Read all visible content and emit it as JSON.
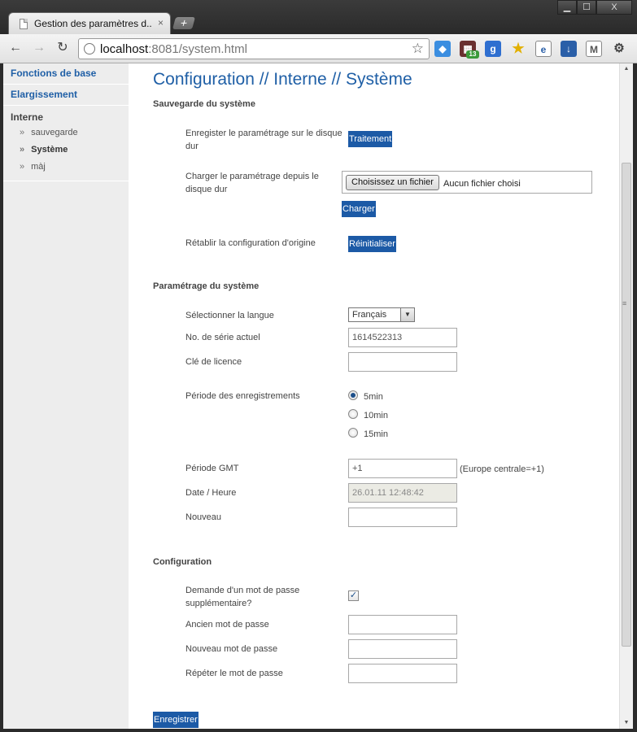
{
  "browser": {
    "tab_title": "Gestion des paramètres d...",
    "tab_close": "×",
    "newtab": "+",
    "url_host": "localhost",
    "url_rest": ":8081/system.html",
    "win_min": "▁",
    "win_max": "☐",
    "win_close": "X",
    "extensions": [
      "dropbox-icon",
      "calendar-icon",
      "google-icon",
      "star-icon",
      "notes-icon",
      "download-icon",
      "gmail-icon",
      "wrench-icon"
    ],
    "ext_badge": "13"
  },
  "sidebar": {
    "items": [
      {
        "label": "Fonctions de base"
      },
      {
        "label": "Elargissement"
      }
    ],
    "group_title": "Interne",
    "subitems": [
      {
        "label": "sauvegarde"
      },
      {
        "label": "Système"
      },
      {
        "label": "màj"
      }
    ],
    "bullet": "»"
  },
  "page": {
    "title": "Configuration // Interne // Système",
    "backup": {
      "section_title": "Sauvegarde du système",
      "save_label": "Enregister le paramétrage sur le disque dur",
      "save_button": "Traitement",
      "load_label": "Charger le paramétrage depuis le disque dur",
      "file_button": "Choisissez un fichier",
      "file_status": "Aucun fichier choisi",
      "load_button": "Charger",
      "reset_label": "Rétablir la configuration d'origine",
      "reset_button": "Réinitialiser"
    },
    "system": {
      "section_title": "Paramétrage du système",
      "language_label": "Sélectionner la langue",
      "language_value": "Français",
      "serial_label": "No. de série actuel",
      "serial_value": "1614522313",
      "license_label": "Clé de licence",
      "license_value": "",
      "period_label": "Période des enregistrements",
      "period_options": [
        "5min",
        "10min",
        "15min"
      ],
      "period_selected": "5min",
      "gmt_label": "Période GMT",
      "gmt_value": "+1",
      "gmt_hint": "(Europe centrale=+1)",
      "datetime_label": "Date / Heure",
      "datetime_value": "26.01.11 12:48:42",
      "new_label": "Nouveau",
      "new_value": ""
    },
    "config": {
      "section_title": "Configuration",
      "password_required_label": "Demande d'un mot de passe supplémentaire?",
      "password_required": true,
      "check_mark": "✓",
      "old_password_label": "Ancien mot de passe",
      "new_password_label": "Nouveau mot de passe",
      "repeat_password_label": "Répéter le mot de passe"
    },
    "save_button": "Enregistrer"
  }
}
